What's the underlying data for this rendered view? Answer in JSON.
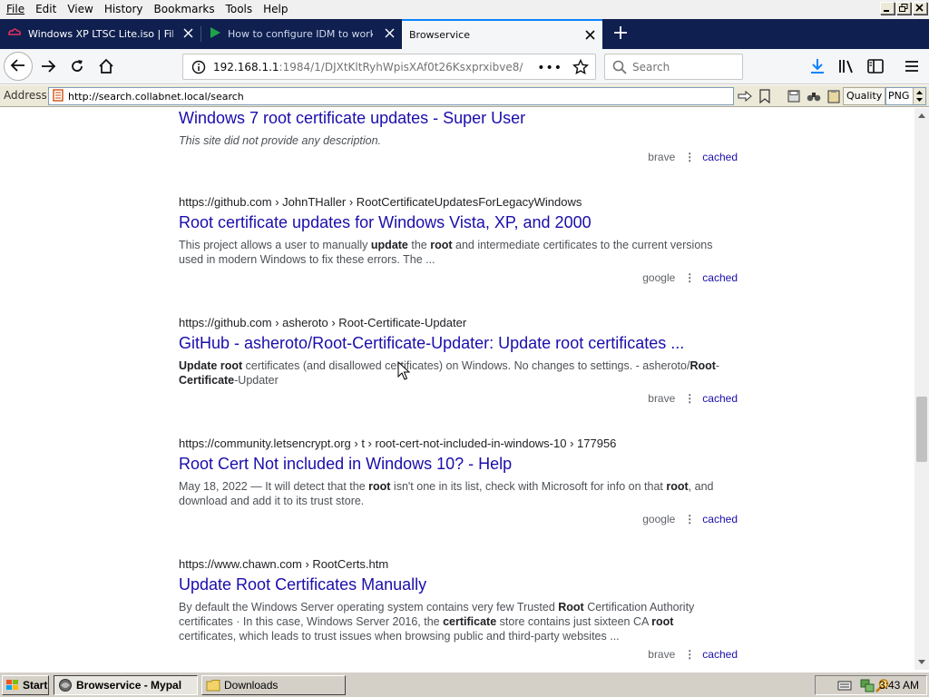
{
  "menu": [
    "File",
    "Edit",
    "View",
    "History",
    "Bookmarks",
    "Tools",
    "Help"
  ],
  "tabs": [
    {
      "title": "Windows XP LTSC Lite.iso | Files.fm",
      "icon": "files-fm-icon"
    },
    {
      "title": "How to configure IDM to work with",
      "icon": "play-arrow-icon"
    },
    {
      "title": "Browservice",
      "active": true
    }
  ],
  "urlbar": {
    "host": "192.168.1.1",
    "path": ":1984/1/DJXtKltRyhWpisXAf0t26Ksxprxibve8/"
  },
  "search": {
    "placeholder": "Search"
  },
  "address": {
    "label": "Address",
    "url": "http://search.collabnet.local/search"
  },
  "quality": {
    "label": "Quality",
    "value": "PNG"
  },
  "results": [
    {
      "url": "",
      "title": "Windows 7 root certificate updates - Super User",
      "desc": "This site did not provide any description.",
      "italic": true,
      "engine": "brave",
      "cached": "cached"
    },
    {
      "url": "https://github.com  › JohnTHaller › RootCertificateUpdatesForLegacyWindows",
      "title": "Root certificate updates for Windows Vista, XP, and 2000",
      "desc_parts": [
        [
          "This project allows a user to manually ",
          false
        ],
        [
          "update",
          true
        ],
        [
          " the ",
          false
        ],
        [
          "root",
          true
        ],
        [
          " and intermediate certificates to the current versions used in modern Windows to fix these errors. The ...",
          false
        ]
      ],
      "engine": "google",
      "cached": "cached"
    },
    {
      "url": "https://github.com  › asheroto › Root-Certificate-Updater",
      "title": "GitHub - asheroto/Root-Certificate-Updater: Update root certificates ...",
      "desc_parts": [
        [
          "Update root",
          true
        ],
        [
          " certificates (and disallowed certificates) on Windows. No changes to settings. - asheroto/",
          false
        ],
        [
          "Root",
          true
        ],
        [
          "-",
          false
        ],
        [
          "Certificate",
          true
        ],
        [
          "-Updater",
          false
        ]
      ],
      "engine": "brave",
      "cached": "cached"
    },
    {
      "url": "https://community.letsencrypt.org  › t › root-cert-not-included-in-windows-10 › 177956",
      "title": "Root Cert Not included in Windows 10? - Help",
      "desc_parts": [
        [
          "May 18, 2022 — It will detect that the ",
          false
        ],
        [
          "root",
          true
        ],
        [
          " isn't one in its list, check with Microsoft for info on that ",
          false
        ],
        [
          "root",
          true
        ],
        [
          ", and download and add it to its trust store.",
          false
        ]
      ],
      "engine": "google",
      "cached": "cached"
    },
    {
      "url": "https://www.chawn.com  › RootCerts.htm",
      "title": "Update Root Certificates Manually",
      "desc_parts": [
        [
          "By default the Windows Server operating system contains very few Trusted ",
          false
        ],
        [
          "Root",
          true
        ],
        [
          " Certification Authority certificates · In this case, Windows Server 2016, the ",
          false
        ],
        [
          "certificate",
          true
        ],
        [
          " store contains just sixteen CA ",
          false
        ],
        [
          "root",
          true
        ],
        [
          " certificates, which leads to trust issues when browsing public and third-party websites ...",
          false
        ]
      ],
      "engine": "brave",
      "cached": "cached"
    }
  ],
  "taskbar": {
    "start": "Start",
    "items": [
      {
        "label": "Browservice - Mypal",
        "active": true
      },
      {
        "label": "Downloads",
        "active": false
      }
    ],
    "clock": "3:43 AM"
  },
  "colors": {
    "link": "#1a0dab",
    "tabstrip": "#0f1f4f",
    "accent": "#0a84ff"
  }
}
